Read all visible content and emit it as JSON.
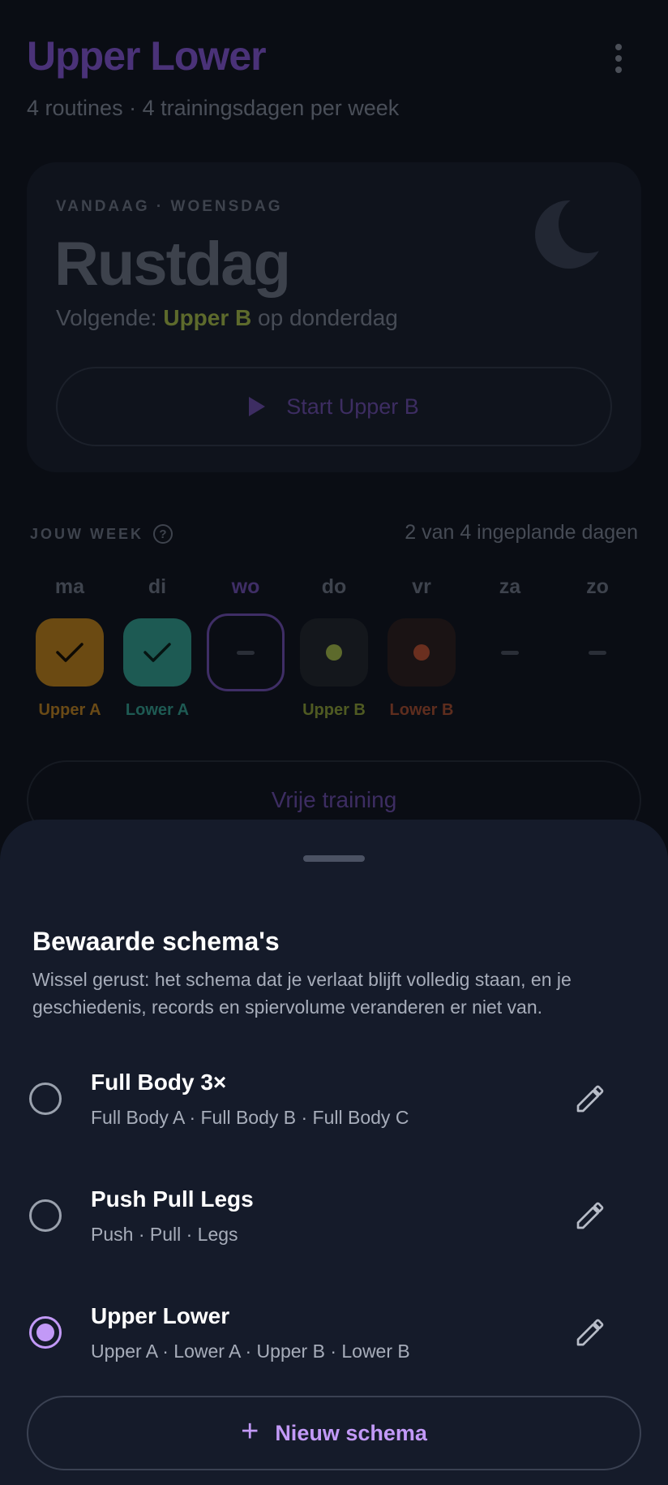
{
  "header": {
    "title": "Upper Lower",
    "subtitle": "4 routines · 4 trainingsdagen per week",
    "menu_icon": "more-vertical-icon"
  },
  "today_card": {
    "eyebrow": "VANDAAG · WOENSDAG",
    "title": "Rustdag",
    "next_prefix": "Volgende: ",
    "next_routine": "Upper B",
    "next_suffix": " op donderdag",
    "start_button": "Start Upper B",
    "icon": "moon-icon"
  },
  "week": {
    "label": "JOUW WEEK",
    "help_glyph": "?",
    "progress": "2 van 4 ingeplande dagen",
    "days": [
      {
        "name": "ma",
        "label": "Upper A",
        "status": "done",
        "color": "#6b4a12"
      },
      {
        "name": "di",
        "label": "Lower A",
        "status": "done",
        "color": "#1d5a53"
      },
      {
        "name": "wo",
        "label": "",
        "status": "today",
        "color": "#3f2e66"
      },
      {
        "name": "do",
        "label": "Upper B",
        "status": "planned",
        "color": "#5d6a2c"
      },
      {
        "name": "vr",
        "label": "Lower B",
        "status": "planned",
        "color": "#6a2f1f"
      },
      {
        "name": "za",
        "label": "",
        "status": "rest",
        "color": ""
      },
      {
        "name": "zo",
        "label": "",
        "status": "rest",
        "color": ""
      }
    ]
  },
  "free_training_button": "Vrije training",
  "sheet": {
    "title": "Bewaarde schema's",
    "description": "Wissel gerust: het schema dat je verlaat blijft volledig staan, en je geschiedenis, records en spiervolume veranderen er niet van.",
    "schemas": [
      {
        "name": "Full Body 3×",
        "routines": "Full Body A · Full Body B · Full Body C",
        "selected": false
      },
      {
        "name": "Push Pull Legs",
        "routines": "Push · Pull · Legs",
        "selected": false
      },
      {
        "name": "Upper Lower",
        "routines": "Upper A · Lower A · Upper B · Lower B",
        "selected": true
      }
    ],
    "new_button": "Nieuw schema",
    "new_icon_glyph": "+"
  },
  "colors": {
    "accent": "#c299f7",
    "sheet_bg": "#151b2a"
  }
}
